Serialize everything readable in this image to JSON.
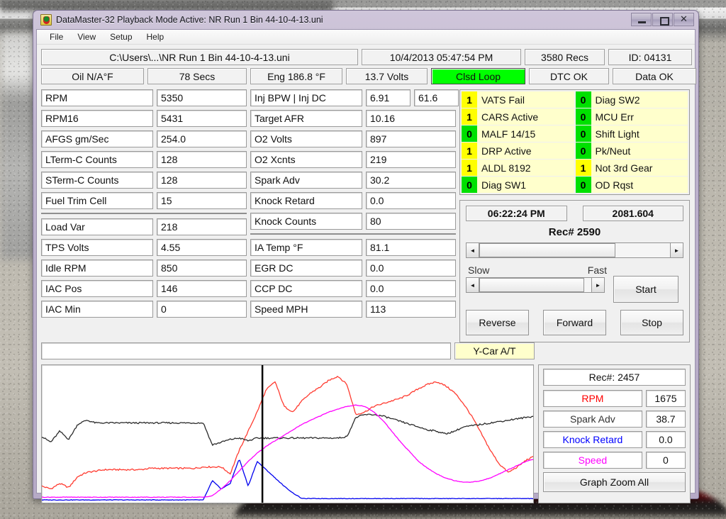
{
  "window": {
    "title": "DataMaster-32  Playback Mode Active: NR Run 1 Bin 44-10-4-13.uni",
    "minimize_label": "",
    "maximize_label": "",
    "close_label": ""
  },
  "menubar": {
    "items": [
      "File",
      "View",
      "Setup",
      "Help"
    ]
  },
  "status_row1": [
    {
      "name": "file-path",
      "text": "C:\\Users\\...\\NR Run 1 Bin 44-10-4-13.uni"
    },
    {
      "name": "timestamp",
      "text": "10/4/2013  05:47:54 PM"
    },
    {
      "name": "record-count",
      "text": "3580 Recs"
    },
    {
      "name": "vehicle-id",
      "text": "ID:  04131"
    }
  ],
  "status_row2": [
    {
      "name": "oil-temp",
      "text": "Oil  N/A°F"
    },
    {
      "name": "elapsed",
      "text": "78 Secs"
    },
    {
      "name": "eng-temp",
      "text": "Eng  186.8 °F"
    },
    {
      "name": "battery",
      "text": "13.7 Volts"
    },
    {
      "name": "loop-state",
      "text": "Clsd Loop",
      "color": "#00ff00"
    },
    {
      "name": "dtc-state",
      "text": "DTC OK"
    },
    {
      "name": "data-state",
      "text": "Data OK"
    }
  ],
  "left_fields_group1": [
    {
      "label": "RPM",
      "value": "5350"
    },
    {
      "label": "RPM16",
      "value": "5431"
    },
    {
      "label": "AFGS gm/Sec",
      "value": "254.0"
    },
    {
      "label": "LTerm-C Counts",
      "value": "128"
    },
    {
      "label": "STerm-C Counts",
      "value": "128"
    },
    {
      "label": "Fuel Trim Cell",
      "value": "15"
    }
  ],
  "left_fields_group2": [
    {
      "label": "Load Var",
      "value": "218"
    },
    {
      "label": "TPS Volts",
      "value": "4.55"
    },
    {
      "label": "Idle RPM",
      "value": "850"
    },
    {
      "label": "IAC Pos",
      "value": "146"
    },
    {
      "label": "IAC Min",
      "value": "0"
    }
  ],
  "mid_fields_group1": [
    {
      "label": "Inj BPW  |  Inj DC",
      "value": "6.91",
      "value2": "61.6"
    },
    {
      "label": "Target AFR",
      "value": "10.16"
    },
    {
      "label": "O2 Volts",
      "value": "897"
    },
    {
      "label": "O2 Xcnts",
      "value": "219"
    },
    {
      "label": "Spark Adv",
      "value": "30.2"
    },
    {
      "label": "Knock Retard",
      "value": "0.0"
    },
    {
      "label": "Knock Counts",
      "value": "80"
    }
  ],
  "mid_fields_group2": [
    {
      "label": "IA Temp °F",
      "value": "81.1"
    },
    {
      "label": "EGR DC",
      "value": "0.0"
    },
    {
      "label": "CCP DC",
      "value": "0.0"
    },
    {
      "label": "Speed MPH",
      "value": "113"
    }
  ],
  "bottom_bar": {
    "empty_field": "",
    "car_type": "Y-Car A/T",
    "car_type_color": "#ffffcc"
  },
  "indicators_left": [
    {
      "bit": "1",
      "label": "VATS Fail",
      "state": "on"
    },
    {
      "bit": "1",
      "label": "CARS Active",
      "state": "on"
    },
    {
      "bit": "0",
      "label": "MALF 14/15",
      "state": "off"
    },
    {
      "bit": "1",
      "label": "DRP Active",
      "state": "on"
    },
    {
      "bit": "1",
      "label": "ALDL 8192",
      "state": "on"
    },
    {
      "bit": "0",
      "label": "Diag SW1",
      "state": "off"
    }
  ],
  "indicators_right": [
    {
      "bit": "0",
      "label": "Diag SW2",
      "state": "off"
    },
    {
      "bit": "0",
      "label": "MCU Err",
      "state": "off"
    },
    {
      "bit": "0",
      "label": "Shift Light",
      "state": "off"
    },
    {
      "bit": "0",
      "label": "Pk/Neut",
      "state": "off"
    },
    {
      "bit": "1",
      "label": "Not 3rd Gear",
      "state": "on"
    },
    {
      "bit": "0",
      "label": "OD Rqst",
      "state": "off"
    }
  ],
  "playback": {
    "clock": "06:22:24 PM",
    "counter": "2081.604",
    "record_label": "Rec# 2590",
    "slow_label": "Slow",
    "fast_label": "Fast",
    "start_label": "Start",
    "stop_label": "Stop",
    "reverse_label": "Reverse",
    "forward_label": "Forward",
    "left_arrow": "◄",
    "right_arrow": "►"
  },
  "legend": {
    "record": "Rec#:  2457",
    "rows": [
      {
        "name": "RPM",
        "value": "1675",
        "color": "#ff0000"
      },
      {
        "name": "Spark Adv",
        "value": "38.7",
        "color": "#333333"
      },
      {
        "name": "Knock Retard",
        "value": "0.0",
        "color": "#0000ff"
      },
      {
        "name": "Speed",
        "value": "0",
        "color": "#ff00ff"
      }
    ],
    "zoom_all_label": "Graph Zoom All"
  },
  "chart_data": {
    "type": "line",
    "title": "",
    "xlabel": "",
    "ylabel": "",
    "grid": false,
    "legend_position": "right-panel",
    "cursor_x_fraction": 0.447,
    "x": [
      0,
      0.01,
      0.02,
      0.03,
      0.04,
      0.05,
      0.06,
      0.07,
      0.08,
      0.09,
      0.1,
      0.12,
      0.14,
      0.16,
      0.18,
      0.2,
      0.22,
      0.24,
      0.26,
      0.28,
      0.3,
      0.32,
      0.34,
      0.36,
      0.38,
      0.4,
      0.42,
      0.44,
      0.46,
      0.48,
      0.5,
      0.52,
      0.54,
      0.56,
      0.58,
      0.6,
      0.62,
      0.64,
      0.66,
      0.68,
      0.7,
      0.72,
      0.74,
      0.76,
      0.78,
      0.8,
      0.82,
      0.84,
      0.86,
      0.88,
      0.9,
      0.92,
      0.94,
      0.96,
      0.98,
      1.0
    ],
    "series": [
      {
        "name": "RPM",
        "color": "#ff3b30",
        "values": [
          0.12,
          0.1,
          0.14,
          0.11,
          0.19,
          0.22,
          0.23,
          0.24,
          0.24,
          0.24,
          0.24,
          0.24,
          0.25,
          0.25,
          0.25,
          0.25,
          0.25,
          0.25,
          0.26,
          0.26,
          0.26,
          0.21,
          0.38,
          0.52,
          0.66,
          0.82,
          0.88,
          0.7,
          0.66,
          0.74,
          0.8,
          0.84,
          0.89,
          0.92,
          0.86,
          0.64,
          0.66,
          0.7,
          0.72,
          0.74,
          0.76,
          0.79,
          0.83,
          0.86,
          0.88,
          0.85,
          0.8,
          0.72,
          0.62,
          0.5,
          0.38,
          0.28,
          0.22,
          0.26,
          0.31,
          0.34
        ]
      },
      {
        "name": "Spark Adv",
        "color": "#2b2b2b",
        "values": [
          0.48,
          0.44,
          0.52,
          0.46,
          0.57,
          0.6,
          0.58,
          0.58,
          0.58,
          0.58,
          0.58,
          0.58,
          0.58,
          0.58,
          0.58,
          0.58,
          0.58,
          0.58,
          0.58,
          0.42,
          0.44,
          0.46,
          0.47,
          0.45,
          0.47,
          0.47,
          0.47,
          0.47,
          0.47,
          0.47,
          0.47,
          0.47,
          0.47,
          0.47,
          0.48,
          0.62,
          0.64,
          0.64,
          0.63,
          0.61,
          0.59,
          0.57,
          0.55,
          0.53,
          0.52,
          0.5,
          0.52,
          0.55,
          0.56,
          0.57,
          0.58,
          0.59,
          0.6,
          0.61,
          0.62,
          0.63
        ]
      },
      {
        "name": "Knock Retard",
        "color": "#0000ee",
        "values": [
          0.02,
          0.02,
          0.02,
          0.02,
          0.02,
          0.02,
          0.02,
          0.02,
          0.02,
          0.02,
          0.02,
          0.02,
          0.02,
          0.02,
          0.02,
          0.02,
          0.02,
          0.02,
          0.02,
          0.16,
          0.1,
          0.14,
          0.32,
          0.12,
          0.3,
          0.24,
          0.18,
          0.12,
          0.07,
          0.03,
          0.03,
          0.03,
          0.03,
          0.03,
          0.03,
          0.03,
          0.03,
          0.03,
          0.03,
          0.03,
          0.03,
          0.03,
          0.03,
          0.03,
          0.03,
          0.03,
          0.03,
          0.03,
          0.03,
          0.03,
          0.03,
          0.03,
          0.03,
          0.03,
          0.03,
          0.03
        ]
      },
      {
        "name": "Speed",
        "color": "#ff00ff",
        "values": [
          0.04,
          0.04,
          0.04,
          0.04,
          0.04,
          0.04,
          0.04,
          0.04,
          0.04,
          0.04,
          0.04,
          0.04,
          0.04,
          0.04,
          0.04,
          0.04,
          0.04,
          0.04,
          0.04,
          0.05,
          0.1,
          0.16,
          0.23,
          0.3,
          0.36,
          0.41,
          0.45,
          0.49,
          0.53,
          0.57,
          0.6,
          0.63,
          0.66,
          0.68,
          0.7,
          0.71,
          0.7,
          0.66,
          0.6,
          0.52,
          0.44,
          0.37,
          0.3,
          0.25,
          0.21,
          0.18,
          0.16,
          0.15,
          0.15,
          0.16,
          0.18,
          0.21,
          0.24,
          0.27,
          0.3,
          0.32
        ]
      }
    ]
  }
}
